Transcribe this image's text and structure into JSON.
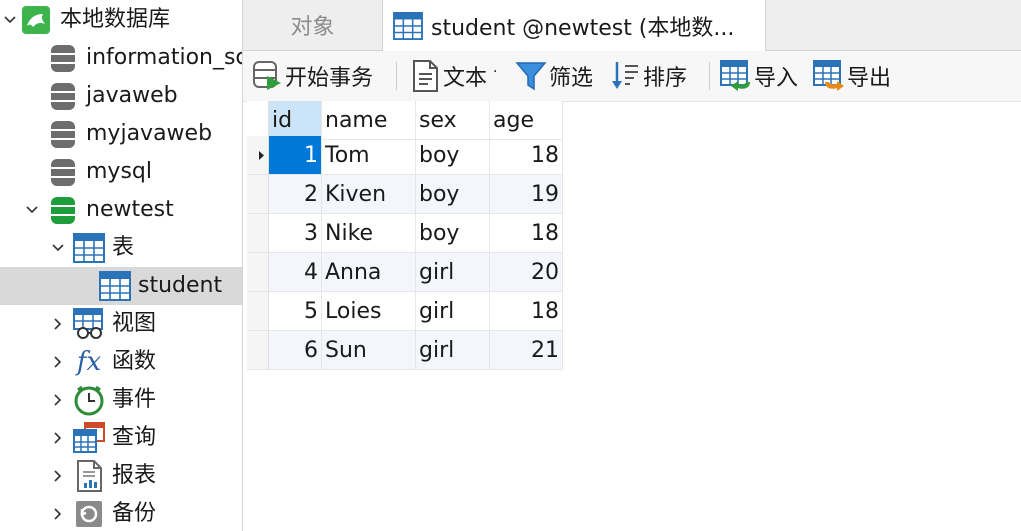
{
  "sidebar": {
    "connection": {
      "label": "本地数据库"
    },
    "databases": [
      {
        "label": "information_schema"
      },
      {
        "label": "javaweb"
      },
      {
        "label": "myjavaweb"
      },
      {
        "label": "mysql"
      },
      {
        "label": "newtest"
      }
    ],
    "folders": [
      {
        "label": "表"
      },
      {
        "label": "视图"
      },
      {
        "label": "函数"
      },
      {
        "label": "事件"
      },
      {
        "label": "查询"
      },
      {
        "label": "报表"
      },
      {
        "label": "备份"
      }
    ],
    "tables": [
      {
        "label": "student"
      }
    ],
    "fx_glyph": "fx"
  },
  "tabs": [
    {
      "label": "对象"
    },
    {
      "label": "student @newtest (本地数..."
    }
  ],
  "toolbar": {
    "begin_transaction": "开始事务",
    "text": "文本",
    "text_arrow": "·",
    "filter": "筛选",
    "sort": "排序",
    "import": "导入",
    "export": "导出"
  },
  "table": {
    "columns": [
      "id",
      "name",
      "sex",
      "age"
    ],
    "rows": [
      [
        "1",
        "Tom",
        "boy",
        "18"
      ],
      [
        "2",
        "Kiven",
        "boy",
        "19"
      ],
      [
        "3",
        "Nike",
        "boy",
        "18"
      ],
      [
        "4",
        "Anna",
        "girl",
        "20"
      ],
      [
        "5",
        "Loies",
        "girl",
        "18"
      ],
      [
        "6",
        "Sun",
        "girl",
        "21"
      ]
    ]
  },
  "colors": {
    "accent": "#0078d7",
    "db_gray": "#6d6d6d",
    "db_green": "#1e9e3a",
    "connection_green": "#3cb44b"
  }
}
